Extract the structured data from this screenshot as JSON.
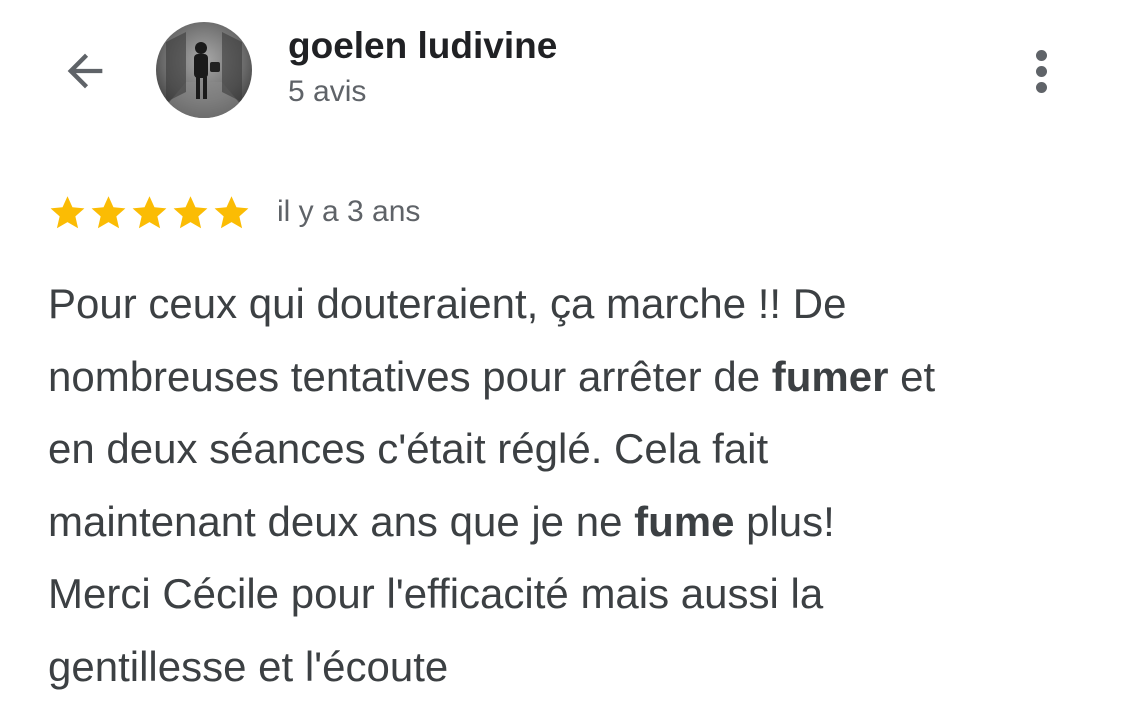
{
  "header": {
    "back_icon": "arrow-back-icon",
    "user_name": "goelen ludivine",
    "review_count": "5 avis",
    "more_icon": "more-vert-icon"
  },
  "review": {
    "rating": 5,
    "max_rating": 5,
    "star_color": "#fbbc04",
    "time": "il y a 3 ans",
    "lines": [
      {
        "parts": [
          {
            "text": "Pour ceux qui douteraient, ça marche !! De",
            "bold": false
          }
        ]
      },
      {
        "parts": [
          {
            "text": "nombreuses tentatives pour arrêter de ",
            "bold": false
          },
          {
            "text": "fumer",
            "bold": true
          },
          {
            "text": " et",
            "bold": false
          }
        ]
      },
      {
        "parts": [
          {
            "text": "en deux séances c'était réglé. Cela fait",
            "bold": false
          }
        ]
      },
      {
        "parts": [
          {
            "text": "maintenant deux ans que je ne ",
            "bold": false
          },
          {
            "text": "fume",
            "bold": true
          },
          {
            "text": " plus!",
            "bold": false
          }
        ]
      },
      {
        "parts": [
          {
            "text": "Merci Cécile pour l'efficacité mais aussi la",
            "bold": false
          }
        ]
      },
      {
        "parts": [
          {
            "text": "gentillesse et l'écoute",
            "bold": false
          }
        ]
      }
    ]
  },
  "colors": {
    "primary_text": "#202124",
    "secondary_text": "#5f6368",
    "body_text": "#3c4043",
    "star": "#fbbc04"
  }
}
